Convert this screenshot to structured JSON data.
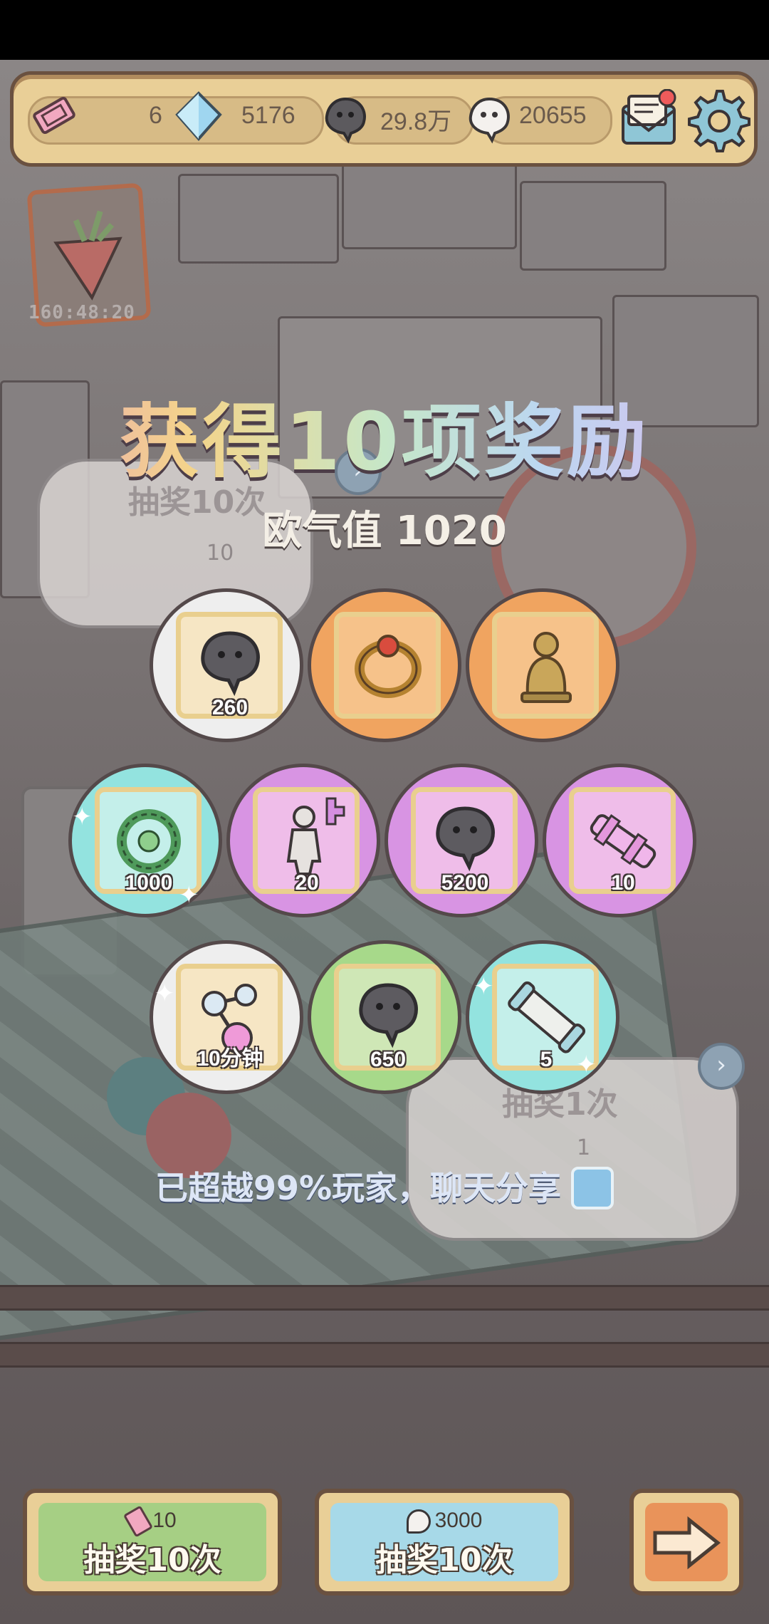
{
  "currencies": {
    "tickets": "6",
    "gems": "5176",
    "dark_spirit": "29.8万",
    "light_spirit": "20655"
  },
  "event_timer": "160:48:20",
  "result": {
    "title": "获得10项奖励",
    "luck_value": "欧气值 1020",
    "share_text": "已超越99%玩家，聊天分享"
  },
  "rewards": [
    {
      "item": "spirit-blob",
      "count": "260",
      "rarity": "white"
    },
    {
      "item": "ring",
      "count": "",
      "rarity": "orange"
    },
    {
      "item": "statue",
      "count": "",
      "rarity": "orange"
    },
    {
      "item": "wreath",
      "count": "1000",
      "rarity": "teal"
    },
    {
      "item": "cupid-statue",
      "count": "20",
      "rarity": "purple"
    },
    {
      "item": "spirit-blob",
      "count": "5200",
      "rarity": "purple"
    },
    {
      "item": "telescope",
      "count": "10",
      "rarity": "purple"
    },
    {
      "item": "molecule",
      "count": "10分钟",
      "rarity": "white"
    },
    {
      "item": "spirit-blob",
      "count": "650",
      "rarity": "green"
    },
    {
      "item": "scroll",
      "count": "5",
      "rarity": "teal"
    }
  ],
  "background": {
    "label_draw10": "抽奖10次",
    "label_draw10_cost": "10",
    "label_draw1": "抽奖1次",
    "label_draw1_cost": "1"
  },
  "buttons": {
    "draw_ticket": {
      "cost": "10",
      "label": "抽奖10次"
    },
    "draw_spirit": {
      "cost": "3000",
      "label": "抽奖10次"
    }
  },
  "colors": {
    "frame": "#6a5140",
    "panel": "#e9cf97",
    "green_button": "#a6cf84",
    "blue_button": "#a7d9e8",
    "orange_button": "#e9935a"
  }
}
